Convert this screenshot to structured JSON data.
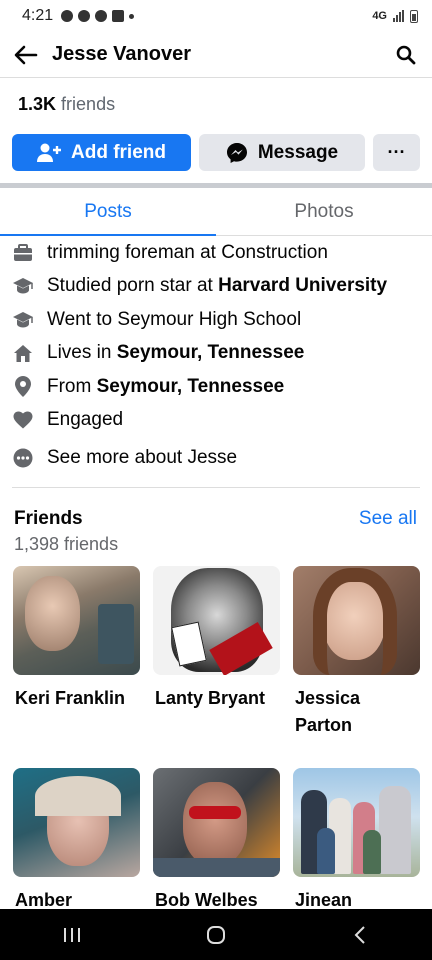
{
  "status_bar": {
    "time": "4:21",
    "network": "4G"
  },
  "header": {
    "title": "Jesse Vanover"
  },
  "profile": {
    "friends_count": "1.3K",
    "friends_label": "friends"
  },
  "actions": {
    "add_friend": "Add friend",
    "message": "Message",
    "more": "···"
  },
  "tabs": [
    {
      "label": "Posts",
      "active": true
    },
    {
      "label": "Photos",
      "active": false
    }
  ],
  "info": [
    {
      "icon": "briefcase-icon",
      "prefix": "trimming foreman at Construction",
      "bold": ""
    },
    {
      "icon": "graduation-cap-icon",
      "prefix": "Studied porn star at ",
      "bold": "Harvard University"
    },
    {
      "icon": "graduation-cap-icon",
      "prefix": "Went to Seymour High School",
      "bold": ""
    },
    {
      "icon": "home-icon",
      "prefix": "Lives in ",
      "bold": "Seymour, Tennessee"
    },
    {
      "icon": "location-pin-icon",
      "prefix": "From ",
      "bold": "Seymour, Tennessee"
    },
    {
      "icon": "heart-icon",
      "prefix": "Engaged",
      "bold": ""
    },
    {
      "icon": "more-dots-icon",
      "prefix": "See more about Jesse",
      "bold": ""
    }
  ],
  "friends_section": {
    "title": "Friends",
    "see_all": "See all",
    "count_text": "1,398 friends",
    "friends": [
      {
        "name": "Keri Franklin"
      },
      {
        "name": "Lanty Bryant"
      },
      {
        "name": "Jessica Parton"
      },
      {
        "name": "Amber"
      },
      {
        "name": "Bob Welbes"
      },
      {
        "name": "Jinean"
      }
    ]
  },
  "colors": {
    "accent": "#1877f2",
    "secondary_button": "#e4e6eb",
    "muted_text": "#65676b"
  }
}
